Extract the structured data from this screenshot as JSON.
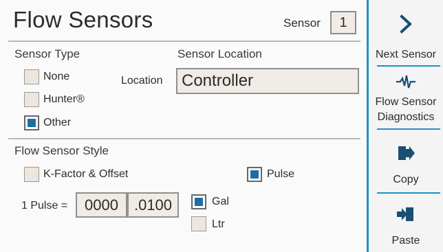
{
  "header": {
    "title": "Flow Sensors",
    "sensor_label": "Sensor",
    "sensor_value": "1"
  },
  "sensor_type": {
    "heading": "Sensor Type",
    "options": [
      {
        "label": "None",
        "checked": false
      },
      {
        "label": "Hunter®",
        "checked": false
      },
      {
        "label": "Other",
        "checked": true
      }
    ]
  },
  "sensor_location": {
    "heading": "Sensor Location",
    "field_label": "Location",
    "value": "Controller"
  },
  "flow_style": {
    "heading": "Flow Sensor Style",
    "kfactor_label": "K-Factor & Offset",
    "kfactor_checked": false,
    "pulse_label": "Pulse",
    "pulse_checked": true
  },
  "pulse": {
    "label": "1 Pulse =",
    "whole": "0000",
    "fraction": ".0100",
    "units": [
      {
        "label": "Gal",
        "checked": true
      },
      {
        "label": "Ltr",
        "checked": false
      }
    ]
  },
  "sidebar": {
    "next": {
      "label": "Next Sensor",
      "icon": "chevron-right-icon"
    },
    "diagnostics": {
      "label_line1": "Flow Sensor",
      "label_line2": "Diagnostics",
      "icon": "waveform-icon"
    },
    "copy": {
      "label": "Copy",
      "icon": "copy-arrow-icon"
    },
    "paste": {
      "label": "Paste",
      "icon": "paste-arrow-icon"
    }
  },
  "colors": {
    "accent": "#1a92c9",
    "checkbox_fill": "#1c6fa3",
    "field_bg": "#f1ebe5"
  }
}
